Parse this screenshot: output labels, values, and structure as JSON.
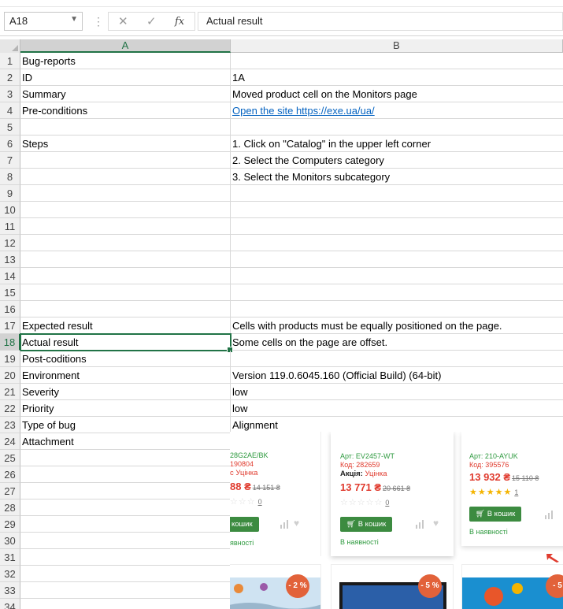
{
  "name_box": {
    "value": "A18"
  },
  "formula": {
    "value": "Actual result",
    "fx_label": "fx",
    "cancel_glyph": "✕",
    "enter_glyph": "✓"
  },
  "columns": [
    "A",
    "B"
  ],
  "rows": [
    {
      "n": "1",
      "a": "Bug-reports",
      "b": ""
    },
    {
      "n": "2",
      "a": "ID",
      "b": "1A"
    },
    {
      "n": "3",
      "a": "Summary",
      "b": "Moved product cell on the Monitors page"
    },
    {
      "n": "4",
      "a": "Pre-conditions",
      "b": "",
      "b_link": "Open the site  https://exe.ua/ua/ "
    },
    {
      "n": "5",
      "a": "",
      "b": ""
    },
    {
      "n": "6",
      "a": "Steps",
      "b": "1. Click on \"Catalog\" in the upper left corner"
    },
    {
      "n": "7",
      "a": "",
      "b": "2. Select the Computers category"
    },
    {
      "n": "8",
      "a": "",
      "b": "3. Select the Monitors subcategory"
    },
    {
      "n": "9",
      "a": "",
      "b": ""
    },
    {
      "n": "10",
      "a": "",
      "b": ""
    },
    {
      "n": "11",
      "a": "",
      "b": ""
    },
    {
      "n": "12",
      "a": "",
      "b": ""
    },
    {
      "n": "13",
      "a": "",
      "b": ""
    },
    {
      "n": "14",
      "a": "",
      "b": ""
    },
    {
      "n": "15",
      "a": "",
      "b": ""
    },
    {
      "n": "16",
      "a": "",
      "b": ""
    },
    {
      "n": "17",
      "a": "Expected result",
      "b": "Cells with products must be equally positioned on the page."
    },
    {
      "n": "18",
      "a": "Actual result",
      "b": "Some cells on the page are offset."
    },
    {
      "n": "19",
      "a": "Post-coditions",
      "b": ""
    },
    {
      "n": "20",
      "a": "Environment",
      "b": "Version 119.0.6045.160 (Official Build) (64-bit)"
    },
    {
      "n": "21",
      "a": "Severity",
      "b": "low"
    },
    {
      "n": "22",
      "a": "Priority",
      "b": "low"
    },
    {
      "n": "23",
      "a": "Type of bug",
      "b": "Alignment"
    },
    {
      "n": "24",
      "a": "Attachment",
      "b": ""
    },
    {
      "n": "25",
      "a": "",
      "b": ""
    },
    {
      "n": "26",
      "a": "",
      "b": ""
    },
    {
      "n": "27",
      "a": "",
      "b": ""
    },
    {
      "n": "28",
      "a": "",
      "b": ""
    },
    {
      "n": "29",
      "a": "",
      "b": ""
    },
    {
      "n": "30",
      "a": "",
      "b": ""
    },
    {
      "n": "31",
      "a": "",
      "b": ""
    },
    {
      "n": "32",
      "a": "",
      "b": ""
    },
    {
      "n": "33",
      "a": "",
      "b": ""
    },
    {
      "n": "34",
      "a": "",
      "b": ""
    }
  ],
  "active_row": "18",
  "attachment": {
    "products": [
      {
        "art": "28G2AE/BK",
        "kod": "190804",
        "promo_label": "",
        "promo_value": "с Уцінка",
        "price": "88 ₴",
        "old_price": "14 151 ₴",
        "stars": "☆☆☆",
        "reviews": "0",
        "buy": "кошик",
        "availability": "явності"
      },
      {
        "art": "Арт: EV2457-WT",
        "kod": "Код: 282659",
        "promo_label": "Акція:",
        "promo_value": " Уцінка",
        "price": "13 771 ₴",
        "old_price": "20 661 ₴",
        "stars": "☆☆☆☆☆",
        "reviews": "0",
        "buy": "В кошик",
        "availability": "В наявності"
      },
      {
        "art": "Арт: 210-AYUK",
        "kod": "Код: 395576",
        "promo_label": "",
        "promo_value": "",
        "price": "13 932 ₴",
        "old_price": "15 110 ₴",
        "stars": "★★★★★",
        "reviews": "1",
        "buy": "В кошик",
        "availability": "В наявності"
      }
    ],
    "discounts": [
      "- 2 %",
      "- 5 %",
      "- 5"
    ],
    "colors": {
      "green": "#3c8b40",
      "red": "#e03b2e",
      "star": "#f4b400",
      "discount": "#e2623a"
    }
  }
}
